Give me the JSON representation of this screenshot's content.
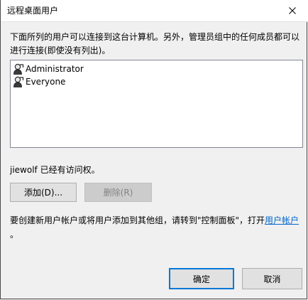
{
  "window": {
    "title": "远程桌面用户"
  },
  "description": "下面所列的用户可以连接到这台计算机。另外，管理员组中的任何成员都可以进行连接(即使没有列出)。",
  "users": [
    {
      "name": "Administrator",
      "icon": "user-icon"
    },
    {
      "name": "Everyone",
      "icon": "user-icon"
    }
  ],
  "access_status": "jiewolf 已经有访问权。",
  "buttons": {
    "add": "添加(D)...",
    "remove": "删除(R)",
    "ok": "确定",
    "cancel": "取消"
  },
  "footer": {
    "text": "要创建新用户帐户或将用户添加到其他组，请转到\"控制面板\"，打开",
    "link": "用户帐户",
    "tail": "。"
  },
  "colors": {
    "link": "#0066cc",
    "accent": "#0078d7"
  }
}
